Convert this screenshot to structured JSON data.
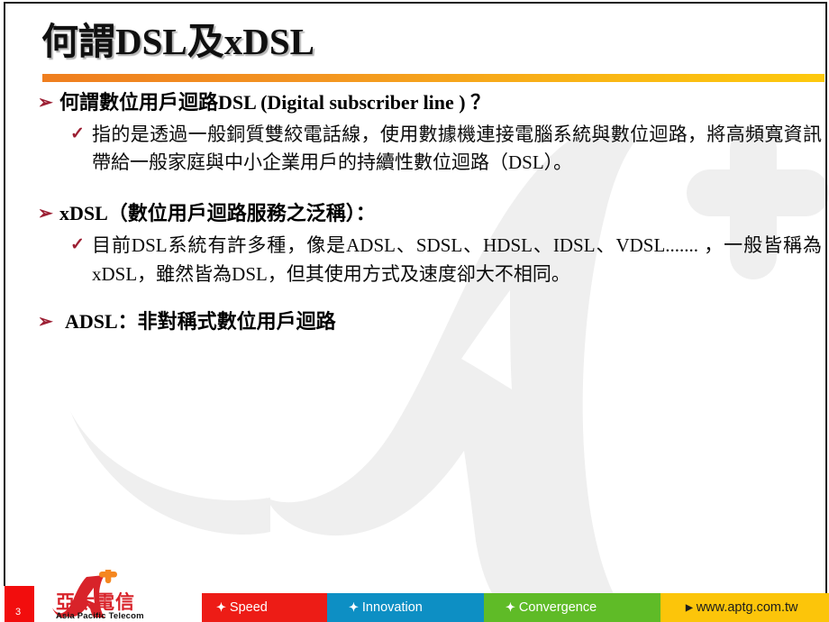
{
  "slide": {
    "title": "何謂DSL及xDSL",
    "page_number": "3",
    "accent_bar_start_color": "#EF7E1F",
    "accent_bar_end_color": "#FDC90D",
    "bullet_color": "#9C1F33"
  },
  "body": {
    "sections": [
      {
        "bullet": "➢",
        "heading": "何謂數位用戶迴路DSL (Digital subscriber line ) ？",
        "sub_bullet": "✓",
        "sub_text": "指的是透過一般銅質雙絞電話線，使用數據機連接電腦系統與數位迴路，將高頻寬資訊帶給一般家庭與中小企業用戶的持續性數位迴路（DSL）。"
      },
      {
        "bullet": "➢",
        "heading": "xDSL（數位用戶迴路服務之泛稱）：",
        "sub_bullet": "✓",
        "sub_text": "目前DSL系統有許多種，像是ADSL、SDSL、HDSL、IDSL、VDSL....... ，一般皆稱為xDSL，雖然皆為DSL，但其使用方式及速度卻大不相同。"
      },
      {
        "bullet": "➢",
        "heading": "ADSL：非對稱式數位用戶迴路",
        "sub_bullet": "",
        "sub_text": ""
      }
    ]
  },
  "footer": {
    "logo_cn": "亞太電信",
    "logo_en": "Asia Pacific Telecom",
    "segments": [
      {
        "marker": "✦",
        "label": "Speed",
        "color": "#ED1C16"
      },
      {
        "marker": "✦",
        "label": "Innovation",
        "color": "#0D8FC4"
      },
      {
        "marker": "✦",
        "label": "Convergence",
        "color": "#5FBB27"
      },
      {
        "marker": "▶",
        "label": "www.aptg.com.tw",
        "color": "#FCC50A"
      }
    ]
  }
}
